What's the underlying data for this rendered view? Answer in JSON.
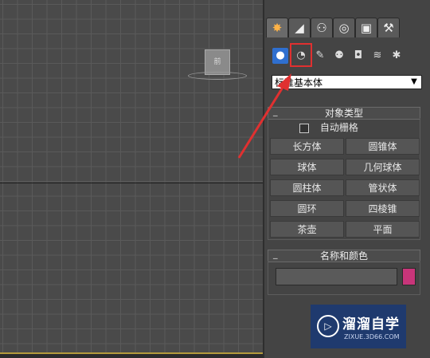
{
  "viewport": {
    "cube_label": "前"
  },
  "command_panel": {
    "tabs": [
      {
        "name": "create",
        "glyph": "✸"
      },
      {
        "name": "modify",
        "glyph": "◢"
      },
      {
        "name": "hierarchy",
        "glyph": "⚇"
      },
      {
        "name": "motion",
        "glyph": "◎"
      },
      {
        "name": "display",
        "glyph": "▣"
      },
      {
        "name": "utilities",
        "glyph": "⚒"
      }
    ],
    "subcategories": [
      {
        "name": "geometry",
        "glyph": "●"
      },
      {
        "name": "shapes",
        "glyph": "◔"
      },
      {
        "name": "lights",
        "glyph": "✎"
      },
      {
        "name": "cameras",
        "glyph": "⚉"
      },
      {
        "name": "helpers",
        "glyph": "◘"
      },
      {
        "name": "space-warps",
        "glyph": "≋"
      },
      {
        "name": "systems",
        "glyph": "✱"
      }
    ],
    "dropdown_value": "标准基本体",
    "object_type": {
      "title": "对象类型",
      "autogrid_label": "自动栅格",
      "buttons": [
        "长方体",
        "圆锥体",
        "球体",
        "几何球体",
        "圆柱体",
        "管状体",
        "圆环",
        "四棱锥",
        "茶壶",
        "平面"
      ]
    },
    "name_color": {
      "title": "名称和颜色",
      "name_value": "",
      "swatch_color": "#c8357a"
    }
  },
  "watermark": {
    "title": "溜溜自学",
    "url": "ZIXUE.3D66.COM"
  },
  "colors": {
    "highlight": "#e03030",
    "active_sub": "#2f6fcf"
  }
}
